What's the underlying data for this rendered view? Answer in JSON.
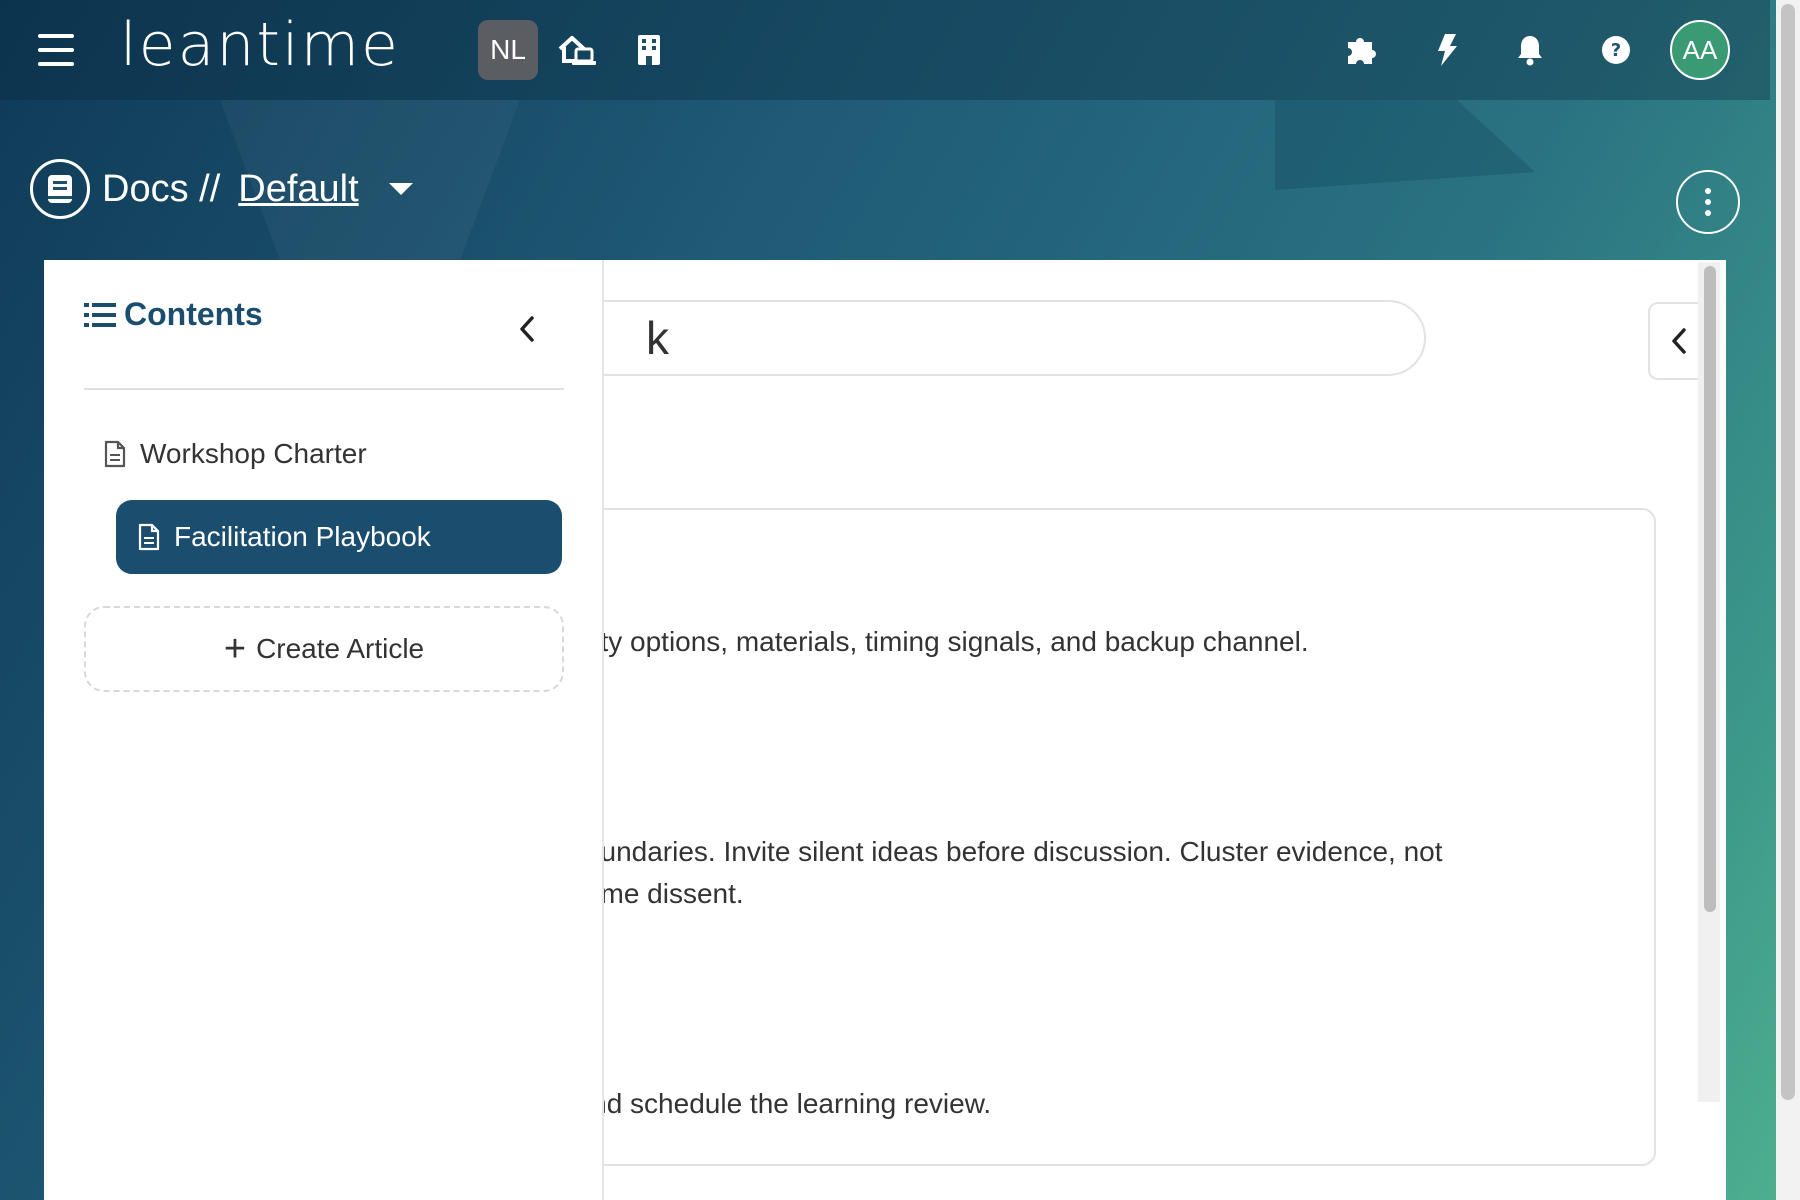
{
  "topbar": {
    "logo_text": "leantime",
    "project_badge": "NL",
    "avatar_initials": "AA",
    "icons": [
      "home-switch-icon",
      "building-icon",
      "puzzle-icon",
      "bolt-icon",
      "bell-icon",
      "help-icon"
    ]
  },
  "header": {
    "title": "Docs //",
    "board_name": "Default"
  },
  "sidebar": {
    "heading": "Contents",
    "items": [
      {
        "label": "Workshop Charter",
        "active": false
      },
      {
        "label": "Facilitation Playbook",
        "active": true
      }
    ],
    "create_label": "Create Article"
  },
  "article": {
    "title_visible": "k",
    "lines": [
      "sibility options, materials, timing signals, and backup channel.",
      "e boundaries. Invite silent ideas before discussion. Cluster evidence, not",
      "d name dissent.",
      "s, and schedule the learning review."
    ]
  },
  "colors": {
    "primary": "#1b4d6e",
    "avatar": "#3a9a74",
    "badge": "#5a5e63"
  }
}
